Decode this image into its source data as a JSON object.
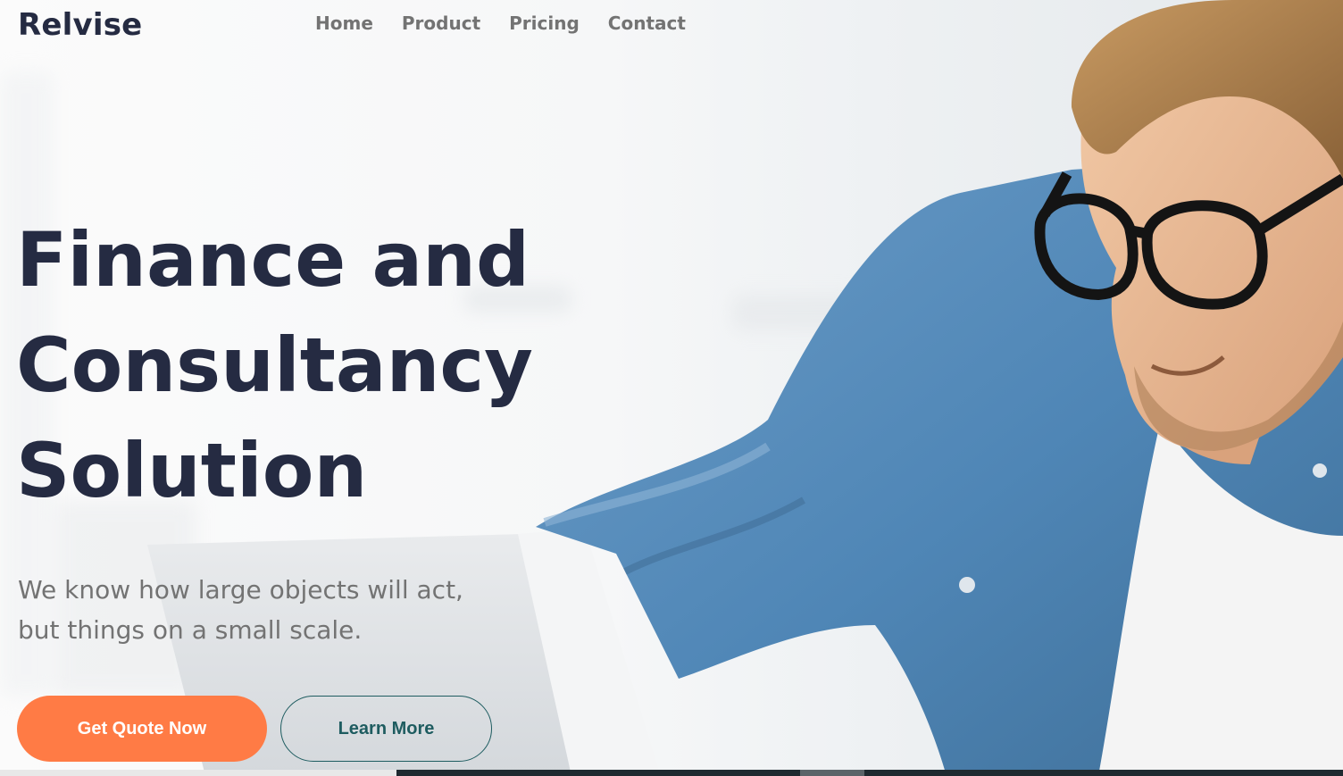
{
  "brand": {
    "logo": "Relvise"
  },
  "nav": {
    "items": [
      {
        "label": "Home"
      },
      {
        "label": "Product"
      },
      {
        "label": "Pricing"
      },
      {
        "label": "Contact"
      }
    ]
  },
  "hero": {
    "title_lines": [
      "Finance and",
      "Consultancy",
      "Solution"
    ],
    "subtitle_lines": [
      "We know how large objects will act,",
      "but things on a small scale."
    ],
    "primary_cta": "Get Quote Now",
    "secondary_cta": "Learn More",
    "image_subject": "man-with-glasses-at-laptop"
  },
  "colors": {
    "heading": "#252b42",
    "nav_text": "#737373",
    "primary_button": "#ff7b45",
    "secondary_button_border": "#1e5c60",
    "shirt": "#4f86b6"
  }
}
